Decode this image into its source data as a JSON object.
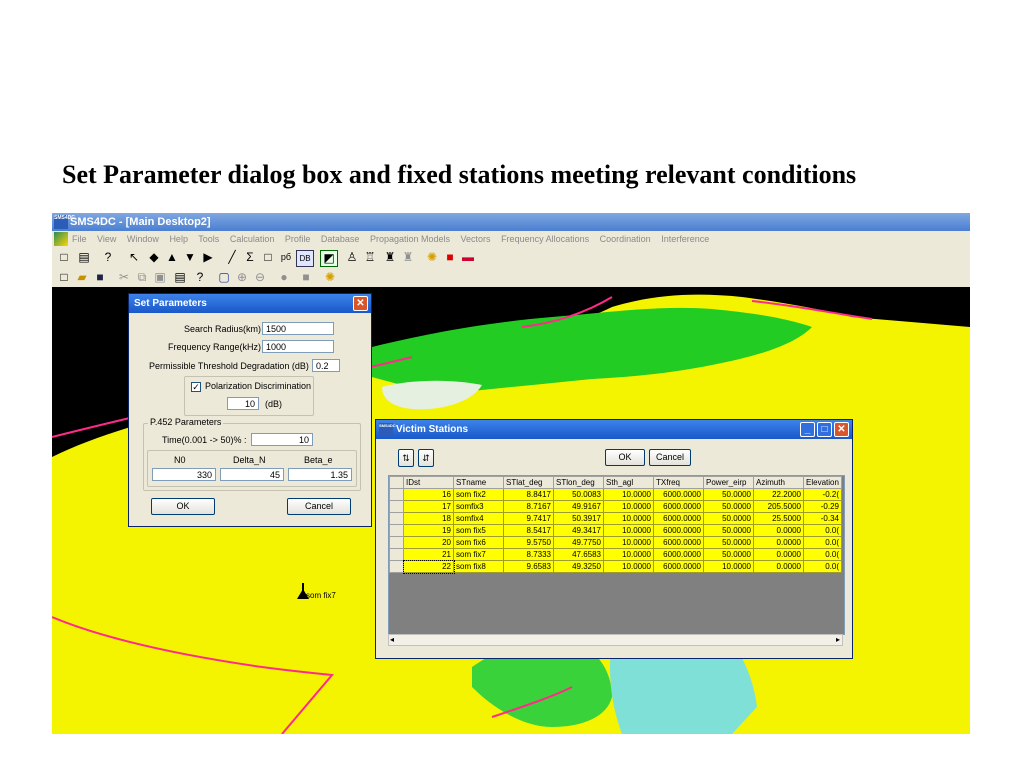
{
  "slide": {
    "title": "Set Parameter dialog box and fixed stations meeting relevant conditions"
  },
  "app": {
    "logo_text": "SMS4DC",
    "window_title": "SMS4DC - [Main Desktop2]",
    "menu": [
      "File",
      "View",
      "Window",
      "Help",
      "Tools",
      "Calculation",
      "Profile",
      "Database",
      "Propagation Models",
      "Vectors",
      "Frequency Allocations",
      "Coordination",
      "Interference"
    ]
  },
  "map": {
    "station_label": "som fix7"
  },
  "set_parameters": {
    "title": "Set Parameters",
    "search_radius_label": "Search Radius(km)",
    "search_radius_value": "1500",
    "frequency_range_label": "Frequency Range(kHz)",
    "frequency_range_value": "1000",
    "threshold_label": "Permissible Threshold Degradation (dB)",
    "threshold_value": "0.2",
    "polarization_label": "Polarization Discrimination",
    "polarization_checked": "✓",
    "polarization_value": "10",
    "polarization_unit": "(dB)",
    "p452_label": "P.452 Parameters",
    "time_label": "Time(0.001 -> 50)% :",
    "time_value": "10",
    "n0_label": "N0",
    "delta_n_label": "Delta_N",
    "beta_e_label": "Beta_e",
    "n0_value": "330",
    "delta_n_value": "45",
    "beta_e_value": "1.35",
    "ok_label": "OK",
    "cancel_label": "Cancel"
  },
  "victim_stations": {
    "logo_text": "SMS4DC",
    "title": "Victim Stations",
    "ok_label": "OK",
    "cancel_label": "Cancel",
    "columns": [
      "IDst",
      "STname",
      "STlat_deg",
      "STlon_deg",
      "Sth_agl",
      "TXfreq",
      "Power_eirp",
      "Azimuth",
      "Elevation"
    ],
    "rows": [
      [
        "16",
        "som fix2",
        "8.8417",
        "50.0083",
        "10.0000",
        "6000.0000",
        "50.0000",
        "22.2000",
        "-0.2("
      ],
      [
        "17",
        "somfix3",
        "8.7167",
        "49.9167",
        "10.0000",
        "6000.0000",
        "50.0000",
        "205.5000",
        "-0.29"
      ],
      [
        "18",
        "somfix4",
        "9.7417",
        "50.3917",
        "10.0000",
        "6000.0000",
        "50.0000",
        "25.5000",
        "-0.34"
      ],
      [
        "19",
        "som fix5",
        "8.5417",
        "49.3417",
        "10.0000",
        "6000.0000",
        "50.0000",
        "0.0000",
        "0.0("
      ],
      [
        "20",
        "som fix6",
        "9.5750",
        "49.7750",
        "10.0000",
        "6000.0000",
        "50.0000",
        "0.0000",
        "0.0("
      ],
      [
        "21",
        "som fix7",
        "8.7333",
        "47.6583",
        "10.0000",
        "6000.0000",
        "50.0000",
        "0.0000",
        "0.0("
      ],
      [
        "22",
        "som fix8",
        "9.6583",
        "49.3250",
        "10.0000",
        "6000.0000",
        "10.0000",
        "0.0000",
        "0.0("
      ]
    ]
  },
  "colors": {
    "map_background": "#000000",
    "terrain_yellow": "#ffff00",
    "terrain_green": "#22cc22",
    "boundary": "#ff2a8a",
    "grid_row": "#ffff00",
    "title_bar": "#1a58c8"
  }
}
